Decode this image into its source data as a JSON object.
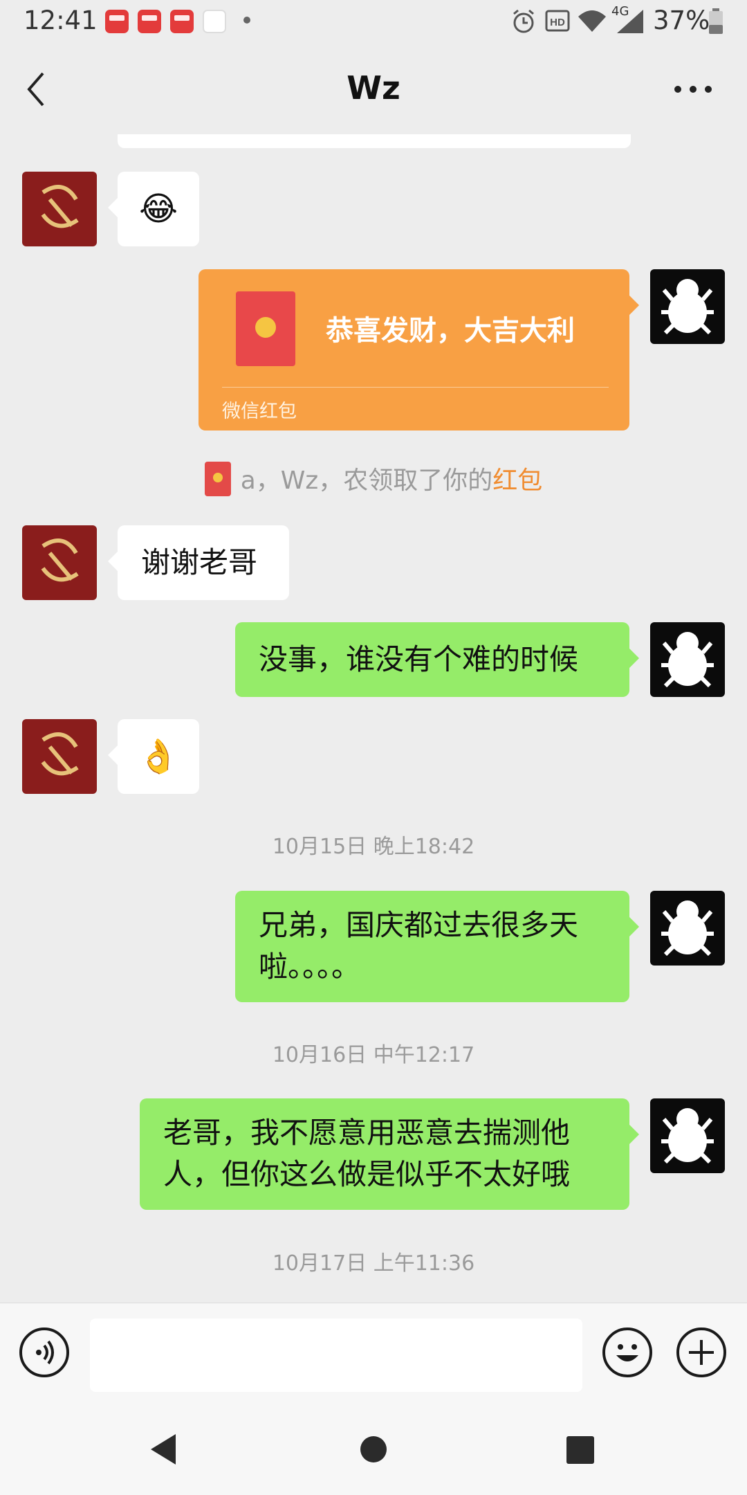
{
  "status_bar": {
    "time": "12:41",
    "app_icons": [
      "app-icon-1",
      "app-icon-2",
      "app-icon-3",
      "app-icon-4"
    ],
    "network": "4G",
    "battery": "37%"
  },
  "header": {
    "title": "Wz"
  },
  "messages": [
    {
      "side": "left",
      "text": "😂"
    },
    {
      "side": "right",
      "type": "red_packet",
      "greeting": "恭喜发财，大吉大利",
      "footer": "微信红包"
    },
    {
      "side": "left",
      "text": "谢谢老哥"
    },
    {
      "side": "right",
      "text": "没事，谁没有个难的时候"
    },
    {
      "side": "left",
      "text": "👌"
    },
    {
      "side": "right",
      "lines": [
        "兄弟，国庆都过去很多天",
        "啦。。。。"
      ]
    },
    {
      "side": "right",
      "lines": [
        "老哥，我不愿意用恶意去揣测他",
        "人，但你这么做是似乎不太好哦"
      ]
    }
  ],
  "notice": {
    "text": "a，Wz，农领取了你的",
    "link": "红包"
  },
  "timestamps": [
    "10月15日 晚上18:42",
    "10月16日 中午12:17",
    "10月17日 上午11:36"
  ],
  "input": {
    "voice_icon": "voice-icon",
    "emoji_icon": "emoji-icon",
    "plus_icon": "plus-icon"
  }
}
